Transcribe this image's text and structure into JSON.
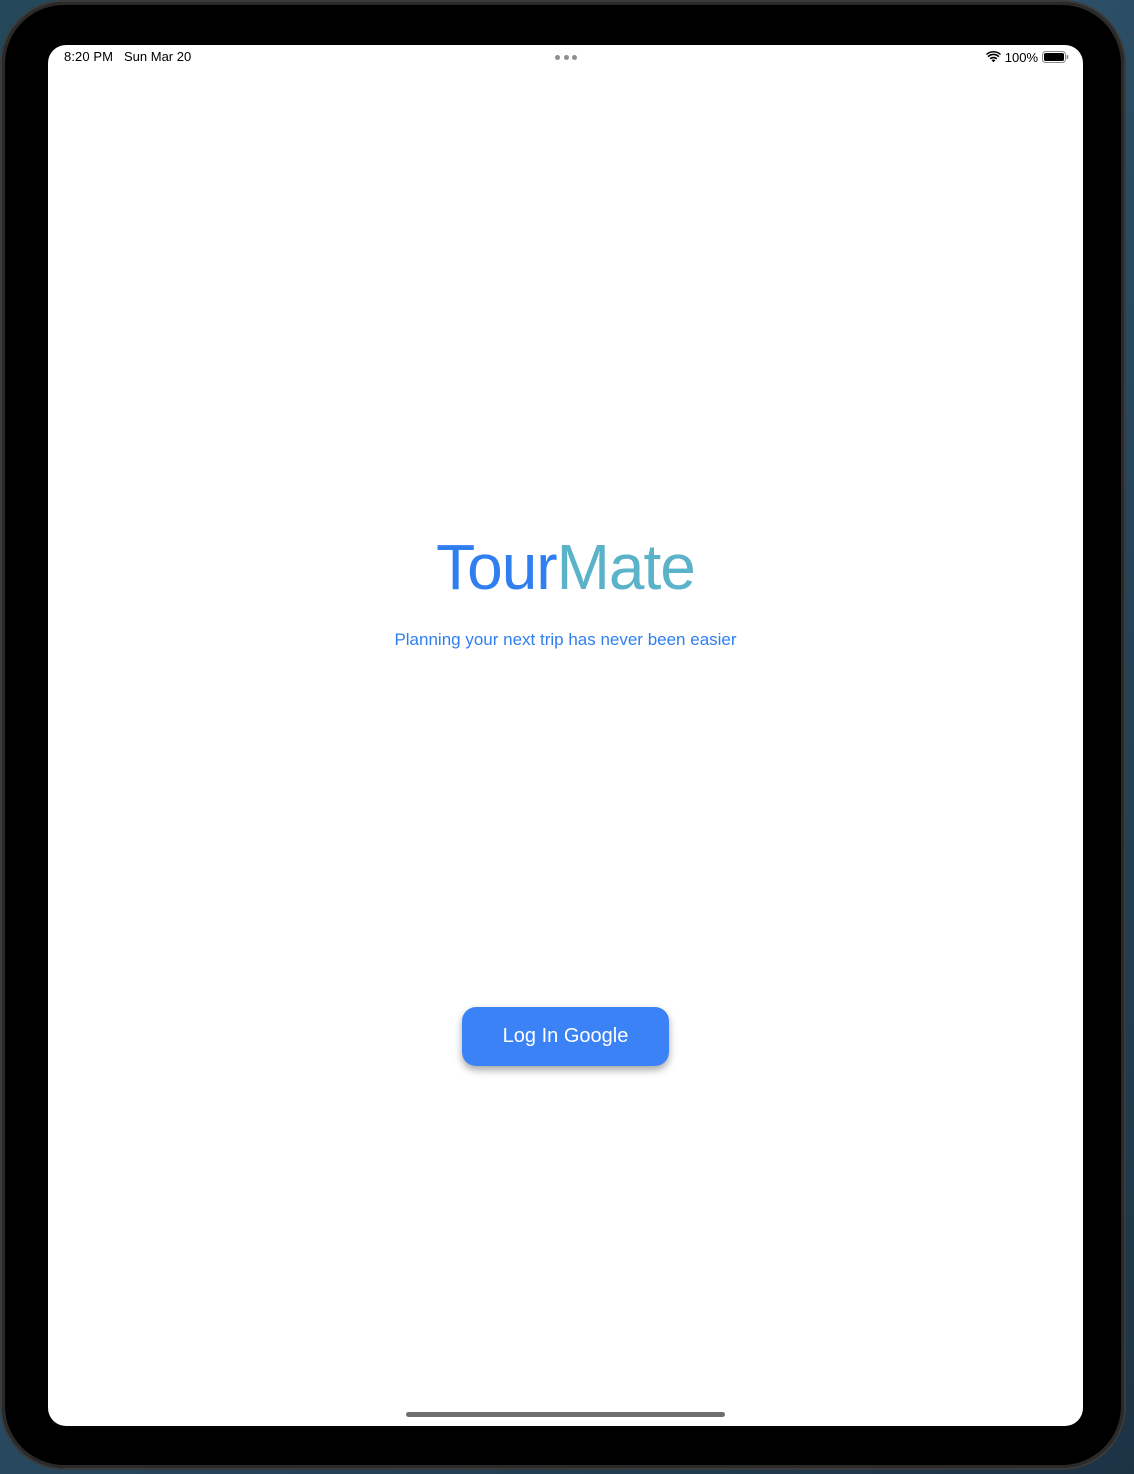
{
  "status_bar": {
    "time": "8:20 PM",
    "date": "Sun Mar 20",
    "battery_percent": "100%",
    "icons": [
      "wifi-icon",
      "battery-icon",
      "multitask-dots-icon"
    ]
  },
  "app": {
    "title_part_1": "Tour",
    "title_part_2": "Mate",
    "tagline": "Planning your next trip has never been easier",
    "colors": {
      "primary": "#2f7ff0",
      "secondary": "#5ab3c9",
      "button": "#3b82f6"
    }
  },
  "actions": {
    "login_label": "Log In Google"
  }
}
